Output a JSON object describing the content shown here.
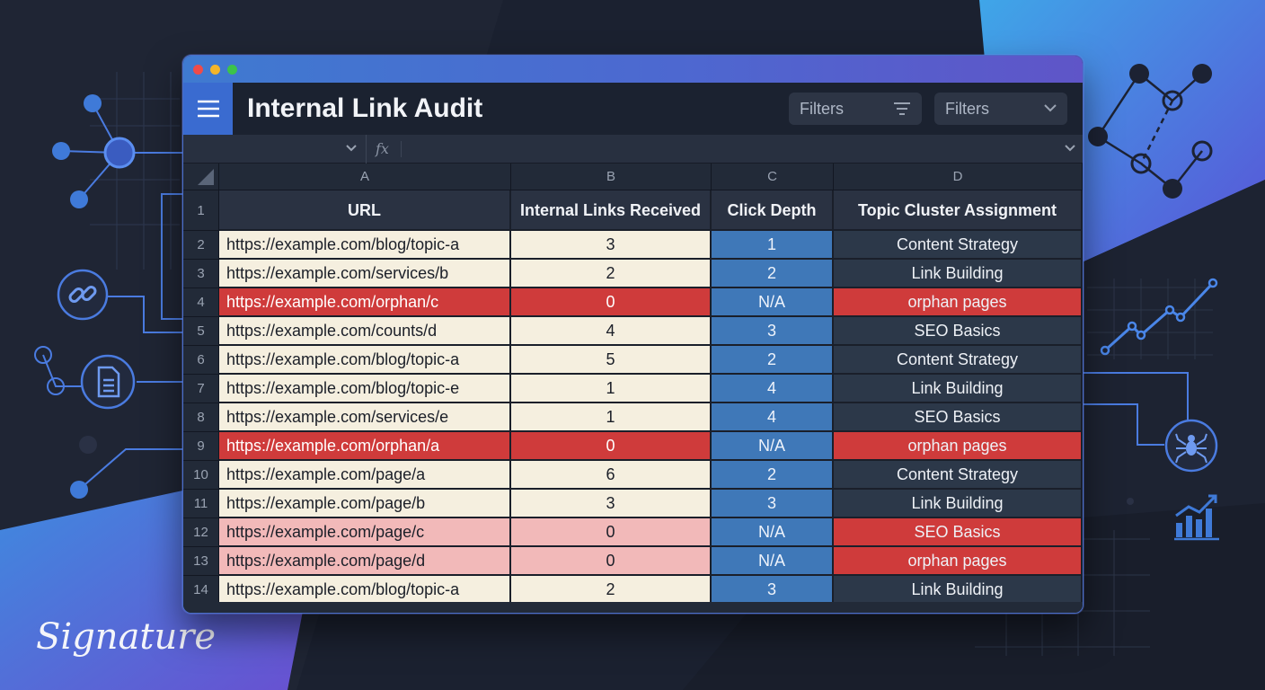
{
  "window": {
    "title": "Internal Link Audit",
    "filters": [
      "Filters",
      "Filters"
    ],
    "formula_symbol": "fx"
  },
  "sheet": {
    "column_letters": [
      "A",
      "B",
      "C",
      "D"
    ],
    "headers": [
      "URL",
      "Internal Links Received",
      "Click Depth",
      "Topic Cluster Assignment"
    ],
    "rows": [
      {
        "n": "2",
        "url": "https://example.com/blog/topic-a",
        "links": "3",
        "depth": "1",
        "cluster": "Content Strategy",
        "url_style": "normal",
        "cluster_style": "normal"
      },
      {
        "n": "3",
        "url": "https://example.com/services/b",
        "links": "2",
        "depth": "2",
        "cluster": "Link Building",
        "url_style": "normal",
        "cluster_style": "normal"
      },
      {
        "n": "4",
        "url": "https://example.com/orphan/c",
        "links": "0",
        "depth": "N/A",
        "cluster": "orphan pages",
        "url_style": "orphan",
        "cluster_style": "red"
      },
      {
        "n": "5",
        "url": "https://example.com/counts/d",
        "links": "4",
        "depth": "3",
        "cluster": "SEO Basics",
        "url_style": "normal",
        "cluster_style": "normal"
      },
      {
        "n": "6",
        "url": "https://example.com/blog/topic-a",
        "links": "5",
        "depth": "2",
        "cluster": "Content Strategy",
        "url_style": "normal",
        "cluster_style": "normal"
      },
      {
        "n": "7",
        "url": "https://example.com/blog/topic-e",
        "links": "1",
        "depth": "4",
        "cluster": "Link Building",
        "url_style": "normal",
        "cluster_style": "normal"
      },
      {
        "n": "8",
        "url": "https://example.com/services/e",
        "links": "1",
        "depth": "4",
        "cluster": "SEO Basics",
        "url_style": "normal",
        "cluster_style": "normal"
      },
      {
        "n": "9",
        "url": "https://example.com/orphan/a",
        "links": "0",
        "depth": "N/A",
        "cluster": "orphan pages",
        "url_style": "orphan",
        "cluster_style": "red"
      },
      {
        "n": "10",
        "url": "https://example.com/page/a",
        "links": "6",
        "depth": "2",
        "cluster": "Content Strategy",
        "url_style": "normal",
        "cluster_style": "normal"
      },
      {
        "n": "11",
        "url": "https://example.com/page/b",
        "links": "3",
        "depth": "3",
        "cluster": "Link Building",
        "url_style": "normal",
        "cluster_style": "normal"
      },
      {
        "n": "12",
        "url": "https://example.com/page/c",
        "links": "0",
        "depth": "N/A",
        "cluster": "SEO Basics",
        "url_style": "zero",
        "cluster_style": "red"
      },
      {
        "n": "13",
        "url": "https://example.com/page/d",
        "links": "0",
        "depth": "N/A",
        "cluster": "orphan pages",
        "url_style": "zero",
        "cluster_style": "red"
      },
      {
        "n": "14",
        "url": "https://example.com/blog/topic-a",
        "links": "2",
        "depth": "3",
        "cluster": "Link Building",
        "url_style": "normal",
        "cluster_style": "normal"
      }
    ]
  },
  "signature": "Signature",
  "colors": {
    "cream": "#f5efdf",
    "orphan_red": "#cf3b3b",
    "soft_pink": "#f2b9b9",
    "depth_blue": "#3f78b8",
    "cluster_dark": "#2c3849",
    "header_dark": "#2a3242",
    "accent": "#3a6bd0"
  },
  "icons": [
    "menu-icon",
    "filter-icon",
    "chevron-down-icon",
    "link-icon",
    "document-icon",
    "spider-icon",
    "bar-chart-icon",
    "line-chart-icon"
  ]
}
